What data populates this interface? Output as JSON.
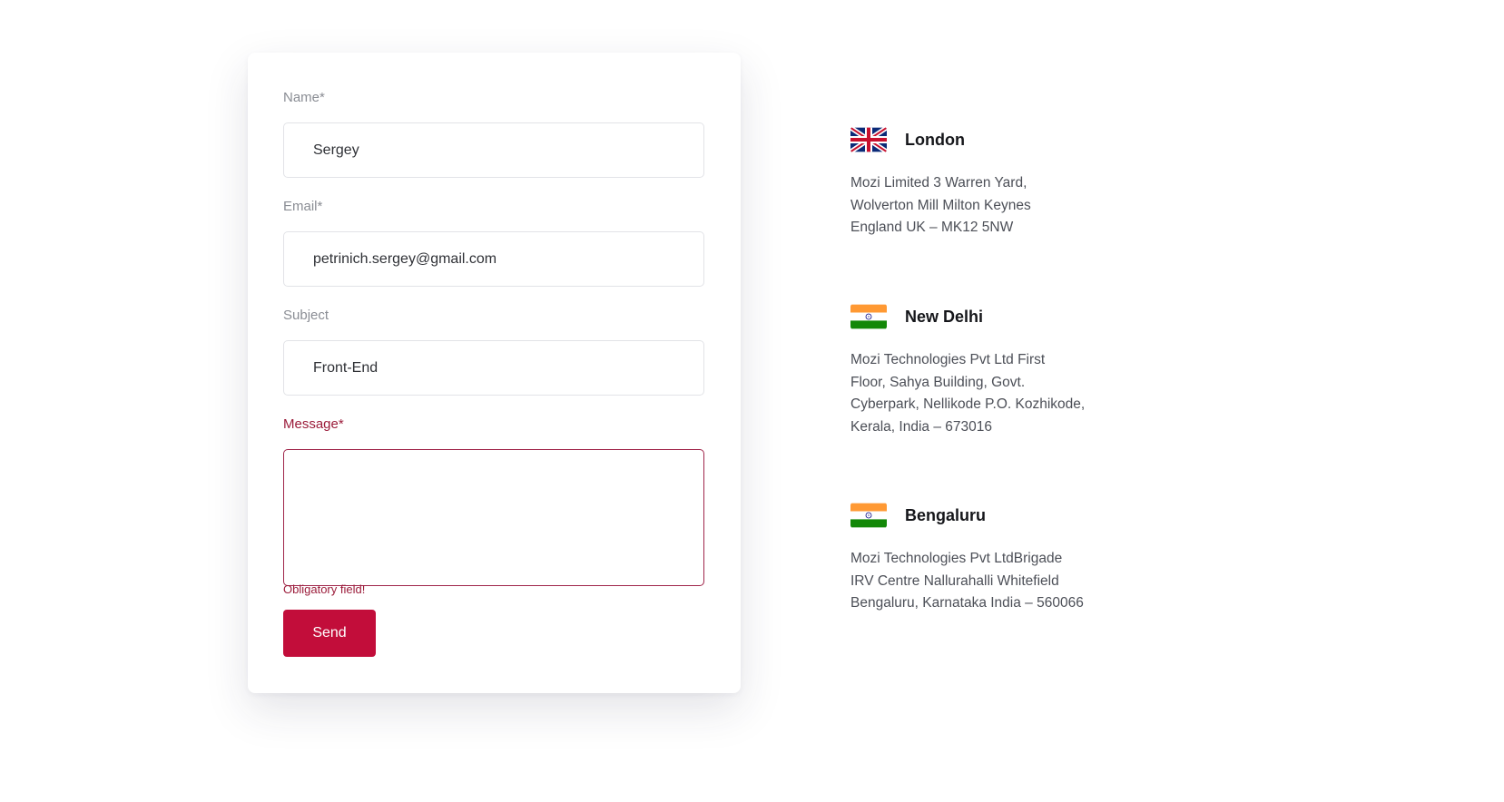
{
  "form": {
    "name": {
      "label": "Name*",
      "value": "Sergey"
    },
    "email": {
      "label": "Email*",
      "value": "petrinich.sergey@gmail.com"
    },
    "subject": {
      "label": "Subject",
      "value": "Front-End"
    },
    "message": {
      "label": "Message*",
      "value": "",
      "error": "Obligatory field!"
    },
    "send_label": "Send"
  },
  "offices": [
    {
      "city": "London",
      "flag": "uk-flag-icon",
      "address_lines": [
        "Mozi Limited 3 Warren Yard,",
        "Wolverton Mill Milton Keynes",
        "England UK – MK12 5NW"
      ]
    },
    {
      "city": "New Delhi",
      "flag": "india-flag-icon",
      "address_lines": [
        "Mozi Technologies Pvt Ltd First",
        "Floor, Sahya Building, Govt.",
        "Cyberpark, Nellikode P.O. Kozhikode,",
        "Kerala, India – 673016"
      ]
    },
    {
      "city": "Bengaluru",
      "flag": "india-flag-icon",
      "address_lines": [
        "Mozi Technologies Pvt LtdBrigade",
        "IRV Centre Nallurahalli Whitefield",
        "Bengaluru, Karnataka India – 560066"
      ]
    }
  ],
  "colors": {
    "accent": "#c20d3a",
    "error": "#9b1c3a",
    "label": "#8a8d94",
    "input_border": "#e2e3e7"
  }
}
